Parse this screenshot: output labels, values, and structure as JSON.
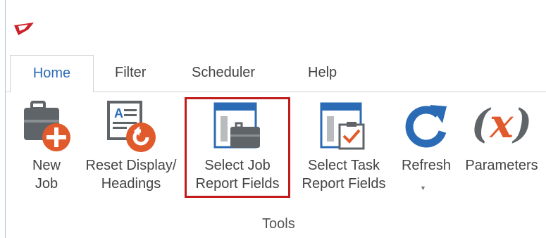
{
  "ribbon": {
    "tabs": [
      {
        "label": "Home",
        "active": true
      },
      {
        "label": "Filter",
        "active": false
      },
      {
        "label": "Scheduler",
        "active": false
      },
      {
        "label": "Help",
        "active": false
      }
    ],
    "buttons": {
      "new_job": "New\nJob",
      "reset_display": "Reset Display/\nHeadings",
      "select_job_report_fields": "Select Job\nReport Fields",
      "select_task_report_fields": "Select Task\nReport Fields",
      "refresh": "Refresh",
      "parameters": "Parameters"
    },
    "group_label": "Tools",
    "parameters_glyph": "(x)"
  },
  "colors": {
    "accent_blue": "#2b6bb5",
    "highlight_red": "#c11b1b",
    "icon_orange": "#e05a2b",
    "icon_gray": "#5f6468",
    "logo_red": "#cc2229"
  }
}
